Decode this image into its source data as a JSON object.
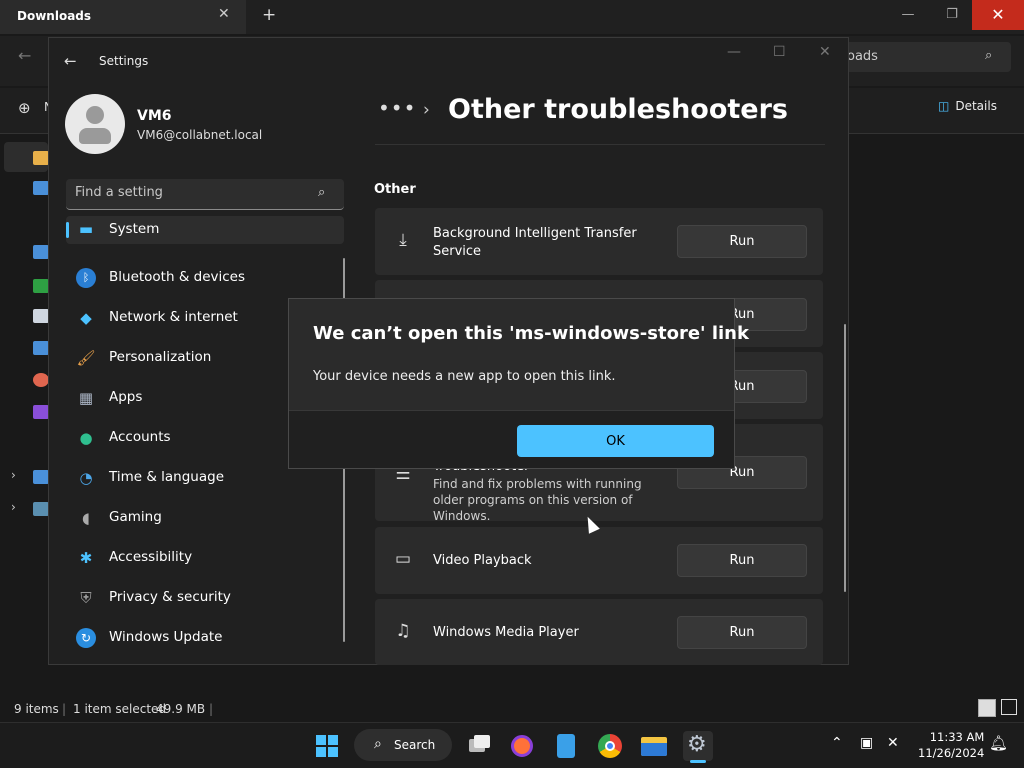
{
  "explorer": {
    "tab_title": "Downloads",
    "search_placeholder": "Search Downloads",
    "search_visible": "oads",
    "cmd_new": "N",
    "details_label": "Details",
    "status": {
      "items": "9 items",
      "selected": "1 item selected",
      "size": "49.9 MB"
    }
  },
  "settings": {
    "window_title": "Settings",
    "user": {
      "name": "VM6",
      "email": "VM6@collabnet.local"
    },
    "search_placeholder": "Find a setting",
    "nav": [
      {
        "label": "System",
        "icon": "monitor-icon",
        "selected": true
      },
      {
        "label": "Bluetooth & devices",
        "icon": "bluetooth-icon"
      },
      {
        "label": "Network & internet",
        "icon": "wifi-icon"
      },
      {
        "label": "Personalization",
        "icon": "brush-icon"
      },
      {
        "label": "Apps",
        "icon": "apps-icon"
      },
      {
        "label": "Accounts",
        "icon": "person-icon"
      },
      {
        "label": "Time & language",
        "icon": "globe-clock-icon"
      },
      {
        "label": "Gaming",
        "icon": "gamepad-icon"
      },
      {
        "label": "Accessibility",
        "icon": "accessibility-icon"
      },
      {
        "label": "Privacy & security",
        "icon": "shield-icon"
      },
      {
        "label": "Windows Update",
        "icon": "update-icon"
      }
    ],
    "breadcrumb_more": "•••",
    "page_title": "Other troubleshooters",
    "section": "Other",
    "troubleshooters": [
      {
        "title": "Background Intelligent Transfer Service",
        "icon": "download-icon",
        "run": "Run"
      },
      {
        "title": "",
        "icon": "",
        "run": "Run"
      },
      {
        "title": "",
        "icon": "",
        "run": "Run"
      },
      {
        "title": "Troubleshooter",
        "desc": "Find and fix problems with running older programs on this version of Windows.",
        "icon": "list-icon",
        "run": "Run"
      },
      {
        "title": "Video Playback",
        "icon": "video-camera-icon",
        "run": "Run"
      },
      {
        "title": "Windows Media Player",
        "icon": "media-player-icon",
        "run": "Run"
      }
    ]
  },
  "dialog": {
    "title": "We can’t open this 'ms-windows-store' link",
    "message": "Your device needs a new app to open this link.",
    "ok_label": "OK"
  },
  "taskbar": {
    "search_label": "Search",
    "time": "11:33 AM",
    "date": "11/26/2024"
  },
  "colors": {
    "accent": "#4cc2ff",
    "close_red": "#c42b1c"
  }
}
